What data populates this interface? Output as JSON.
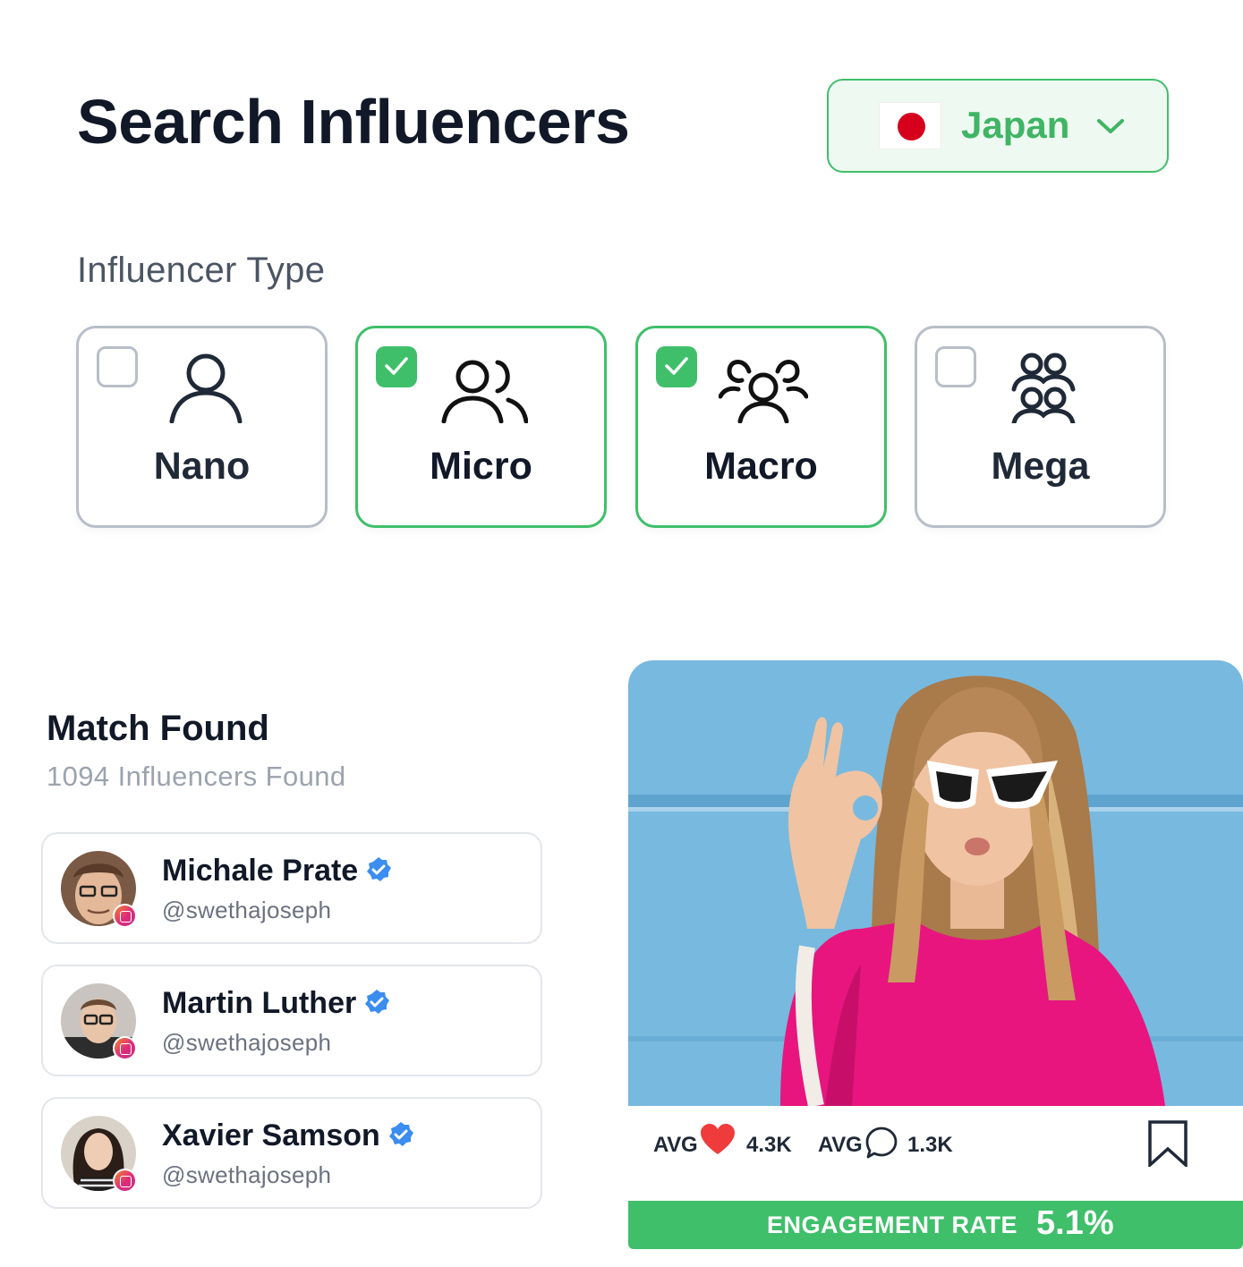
{
  "search": {
    "title": "Search Influencers",
    "country": {
      "name": "Japan",
      "flag_icon": "japan-flag-icon"
    },
    "type_label": "Influencer Type",
    "types": [
      {
        "label": "Nano",
        "checked": false
      },
      {
        "label": "Micro",
        "checked": true
      },
      {
        "label": "Macro",
        "checked": true
      },
      {
        "label": "Mega",
        "checked": false
      }
    ]
  },
  "match": {
    "title": "Match Found",
    "subtitle": "1094 Influencers Found",
    "influencers": [
      {
        "name": "Michale Prate",
        "handle": "@swethajoseph",
        "platform": "instagram",
        "verified": true
      },
      {
        "name": "Martin Luther",
        "handle": "@swethajoseph",
        "platform": "instagram",
        "verified": true
      },
      {
        "name": "Xavier Samson",
        "handle": "@swethajoseph",
        "platform": "instagram",
        "verified": true
      }
    ]
  },
  "post": {
    "avg_likes_label": "AVG",
    "avg_likes": "4.3K",
    "avg_comments_label": "AVG",
    "avg_comments": "1.3K",
    "engagement_label": "ENGAGEMENT RATE",
    "engagement_value": "5.1%"
  },
  "colors": {
    "accent": "#3fbf6a",
    "accent_text": "#3fb565",
    "accent_bg": "#eefaf1",
    "heart": "#ef3b3b",
    "verified": "#3b8df0"
  }
}
